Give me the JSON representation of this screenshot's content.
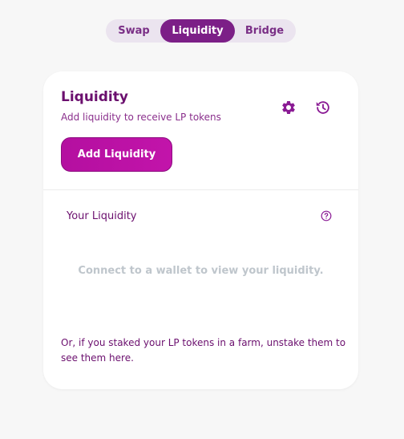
{
  "tabs": [
    {
      "label": "Swap",
      "active": false
    },
    {
      "label": "Liquidity",
      "active": true
    },
    {
      "label": "Bridge",
      "active": false
    }
  ],
  "card": {
    "title": "Liquidity",
    "subtitle": "Add liquidity to receive LP tokens",
    "settings_icon": "gear-icon",
    "history_icon": "history-icon",
    "add_button_label": "Add Liquidity",
    "your_liquidity_label": "Your Liquidity",
    "help_icon": "question-circle-icon",
    "empty_message": "Connect to a wallet to view your liquidity.",
    "footer_note": "Or, if you staked your LP tokens in a farm, unstake them to see them here."
  },
  "colors": {
    "accent": "#7c1f87",
    "button": "#c214aa",
    "text_primary": "#6b0f6e",
    "muted": "#bfc6cc",
    "background": "#f7f7f7"
  }
}
